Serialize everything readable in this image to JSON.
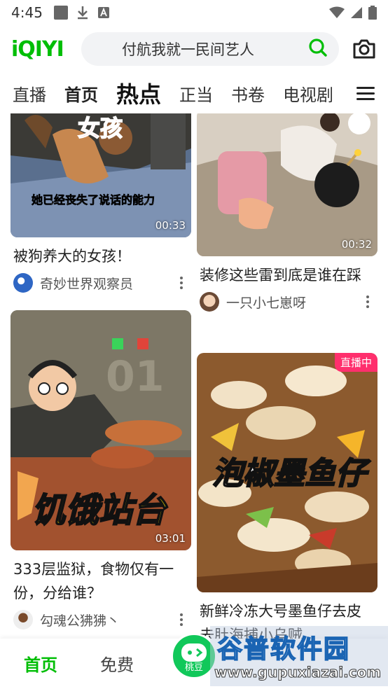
{
  "status_bar": {
    "time": "4:45"
  },
  "header": {
    "logo": "iQIYI",
    "search_value": "付航我就一民间艺人"
  },
  "tabs": [
    {
      "label": "直播"
    },
    {
      "label": "首页"
    },
    {
      "label": "热点"
    },
    {
      "label": "正当"
    },
    {
      "label": "书卷"
    },
    {
      "label": "电视剧"
    }
  ],
  "feed": {
    "left": [
      {
        "title": "被狗养大的女孩！",
        "author": "奇妙世界观察员",
        "duration": "00:33",
        "overlay_title": "女孩",
        "overlay_caption": "她已经丧失了说话的能力"
      },
      {
        "title": "333层监狱，食物仅有一份，分给谁？",
        "author": "勾魂公狒狒丶",
        "duration": "03:01",
        "overlay_title": "饥饿站台",
        "overlay_number": "01"
      }
    ],
    "right": [
      {
        "title": "装修这些雷到底是谁在踩",
        "author": "一只小七崽呀",
        "duration": "00:32"
      },
      {
        "title": "新鲜冷冻大号墨鱼仔去皮去肚海捕小乌贼",
        "author": "",
        "badge": "直播中",
        "overlay_title": "泡椒墨鱼仔"
      }
    ]
  },
  "bottom_nav": {
    "home": "首页",
    "free": "免费",
    "peach": "桃豆"
  },
  "watermark": {
    "title": "谷普软件园",
    "url": "www.gupuxiazai.com"
  },
  "colors": {
    "brand": "#00be06",
    "live_badge": "#ff2f6d",
    "search_bg": "#f2f3f5"
  }
}
